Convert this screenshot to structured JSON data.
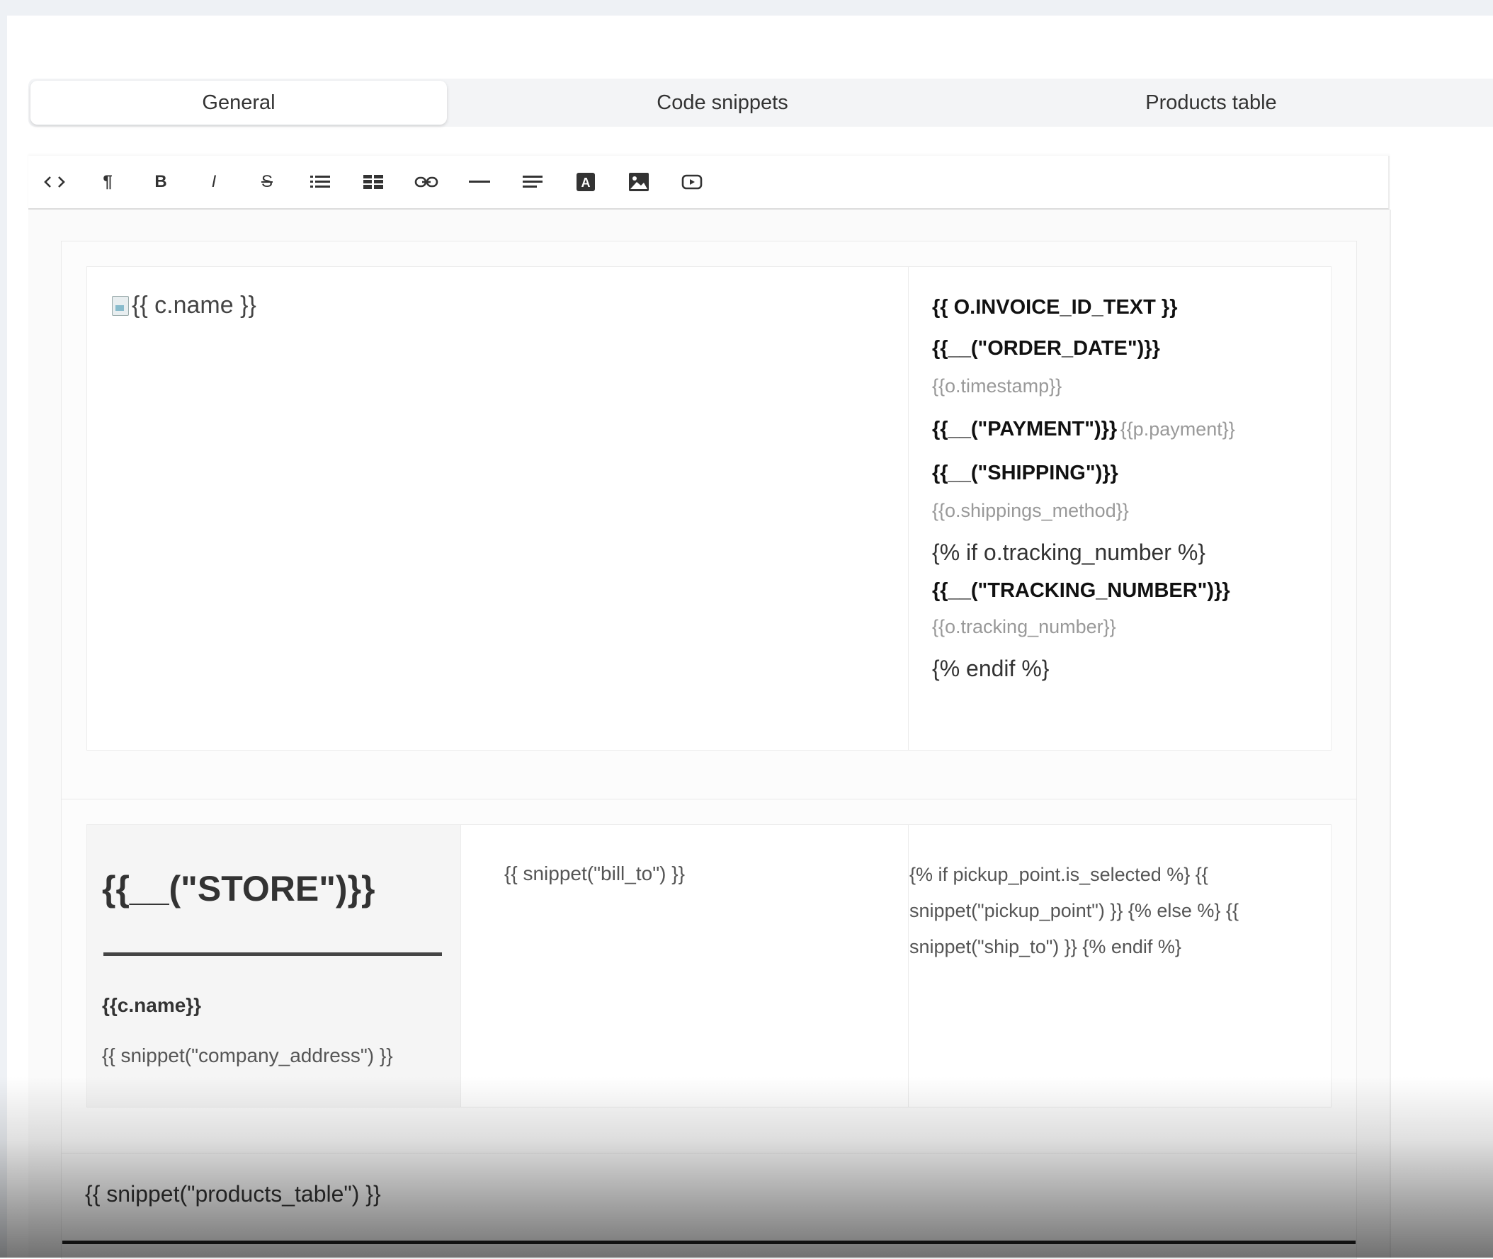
{
  "tabs": [
    {
      "label": "General",
      "active": true
    },
    {
      "label": "Code snippets",
      "active": false
    },
    {
      "label": "Products table",
      "active": false
    }
  ],
  "toolbar": {
    "buttons": [
      {
        "icon": "code-icon",
        "glyph": "<>"
      },
      {
        "icon": "paragraph-icon",
        "glyph": "¶"
      },
      {
        "icon": "bold-icon",
        "glyph": "B"
      },
      {
        "icon": "italic-icon",
        "glyph": "I"
      },
      {
        "icon": "strikethrough-icon",
        "glyph": "S"
      },
      {
        "icon": "bulleted-list-icon",
        "glyph": ""
      },
      {
        "icon": "table-icon",
        "glyph": ""
      },
      {
        "icon": "link-icon",
        "glyph": ""
      },
      {
        "icon": "horizontal-rule-icon",
        "glyph": ""
      },
      {
        "icon": "align-icon",
        "glyph": ""
      },
      {
        "icon": "text-color-icon",
        "glyph": "A"
      },
      {
        "icon": "image-icon",
        "glyph": ""
      },
      {
        "icon": "video-icon",
        "glyph": ""
      }
    ]
  },
  "header": {
    "logo_alt": "{{ c.name }}",
    "invoice_id": "{{ O.INVOICE_ID_TEXT }}",
    "order_date_label": "{{__(\"ORDER_DATE\")}}",
    "timestamp": "{{o.timestamp}}",
    "payment_label": "{{__(\"PAYMENT\")}}",
    "payment_value": "{{p.payment}}",
    "shipping_label": "{{__(\"SHIPPING\")}}",
    "shipping_value": "{{o.shippings_method}}",
    "if_tracking": "{% if o.tracking_number %}",
    "tracking_label": "{{__(\"TRACKING_NUMBER\")}}",
    "tracking_value": "{{o.tracking_number}}",
    "endif": "{% endif %}"
  },
  "addresses": {
    "store_title": "{{__(\"STORE\")}}",
    "company_name": "{{c.name}}",
    "company_address": "{{ snippet(\"company_address\") }}",
    "bill_to": "{{ snippet(\"bill_to\") }}",
    "ship_to": "{% if pickup_point.is_selected %} {{ snippet(\"pickup_point\") }} {% else %} {{ snippet(\"ship_to\") }} {% endif %}"
  },
  "products": {
    "snippet": "{{ snippet(\"products_table\") }}"
  }
}
